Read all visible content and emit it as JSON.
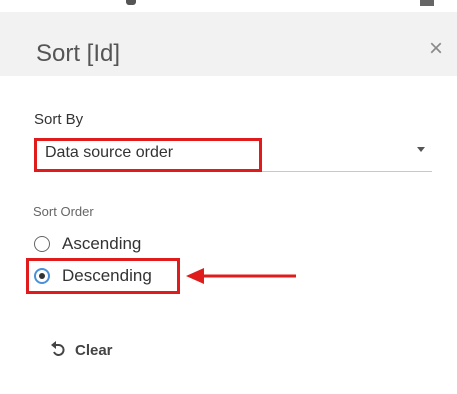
{
  "dialog": {
    "title": "Sort [Id]",
    "close_glyph": "×"
  },
  "sort_by": {
    "label": "Sort By",
    "selected": "Data source order"
  },
  "sort_order": {
    "label": "Sort Order",
    "options": [
      {
        "label": "Ascending",
        "checked": false
      },
      {
        "label": "Descending",
        "checked": true
      }
    ]
  },
  "clear": {
    "label": "Clear",
    "icon": "undo-icon"
  },
  "colors": {
    "highlight": "#e01b1b",
    "radio_accent": "#4a90d9"
  }
}
